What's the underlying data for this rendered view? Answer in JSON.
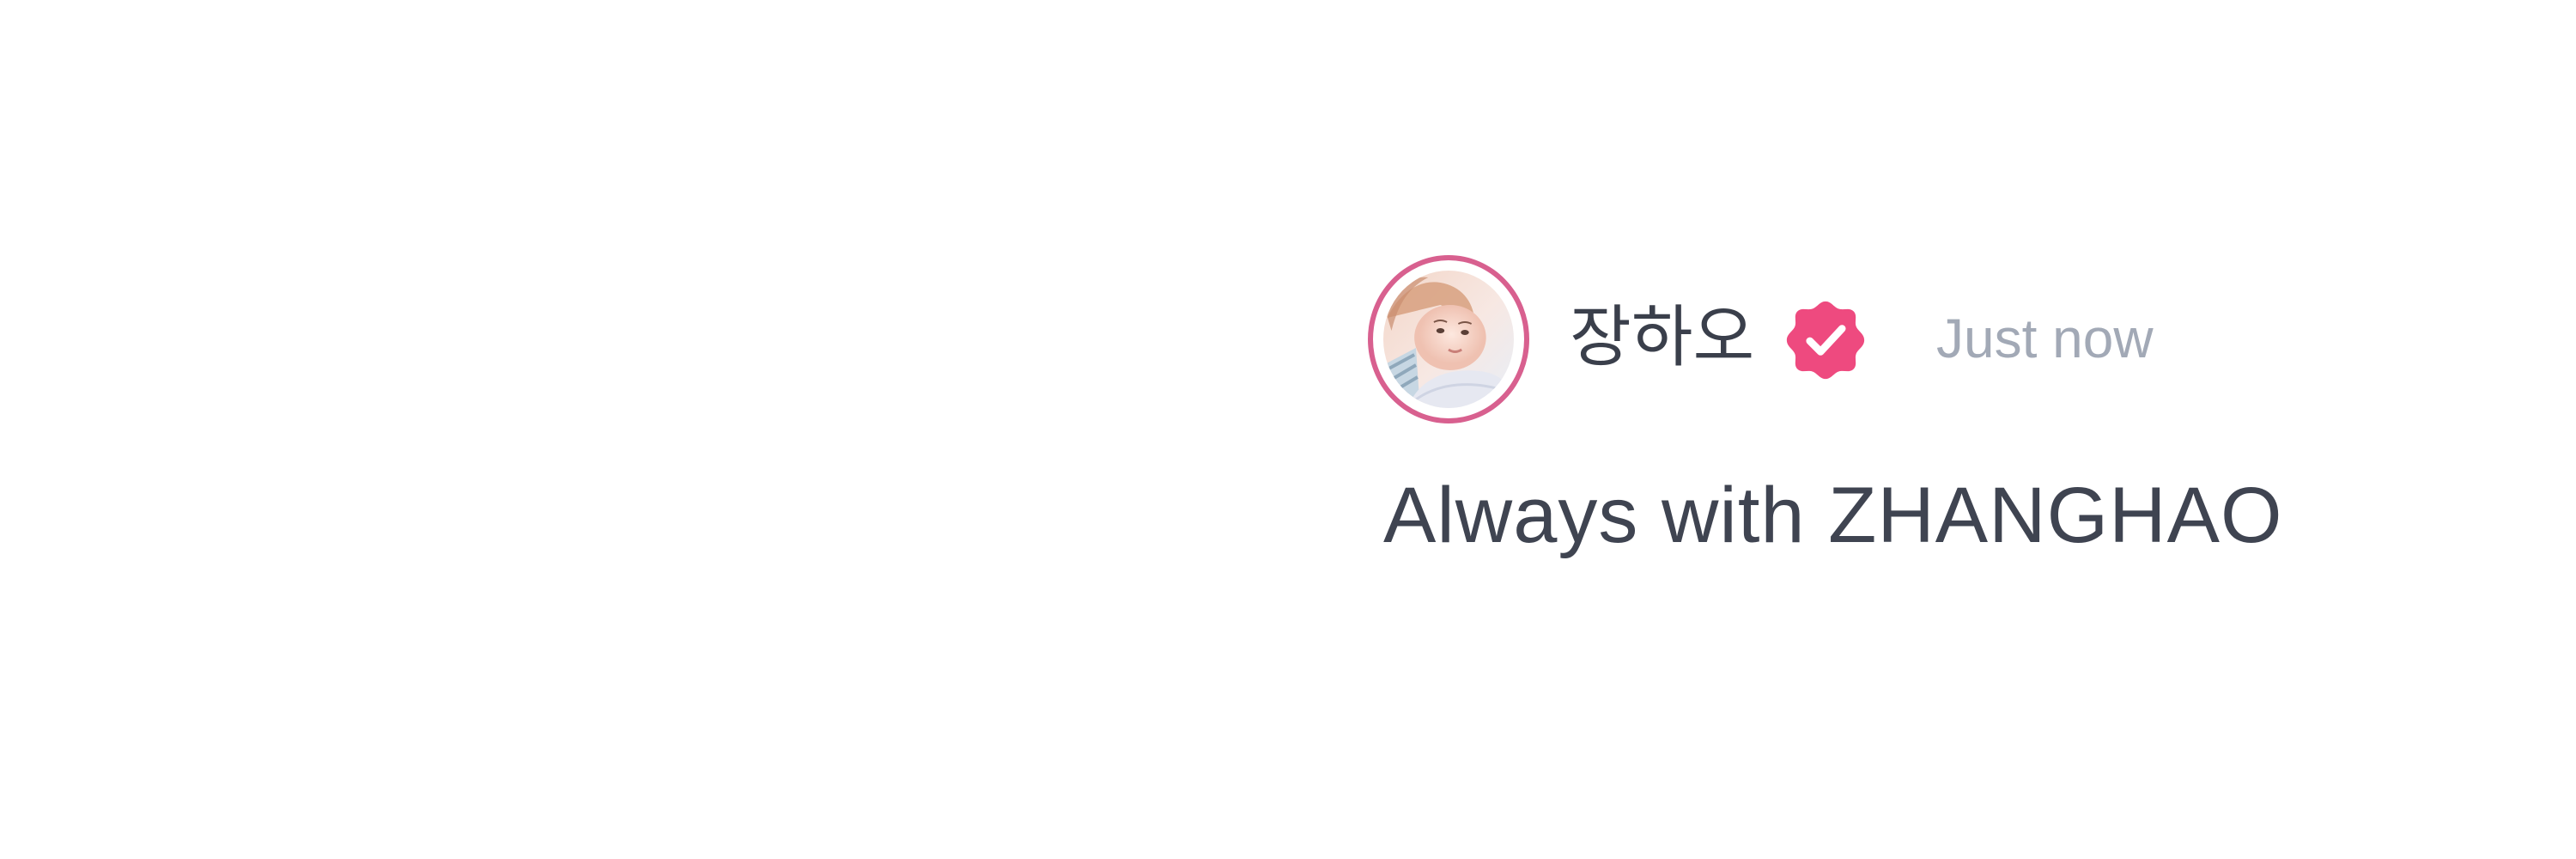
{
  "post": {
    "author": {
      "name": "장하오",
      "verified": true,
      "avatar_icon": "profile-photo",
      "ring_color": "#d8608f",
      "badge_color": "#ee4a7f"
    },
    "timestamp": "Just now",
    "text": "Always with ZHANGHAO"
  }
}
